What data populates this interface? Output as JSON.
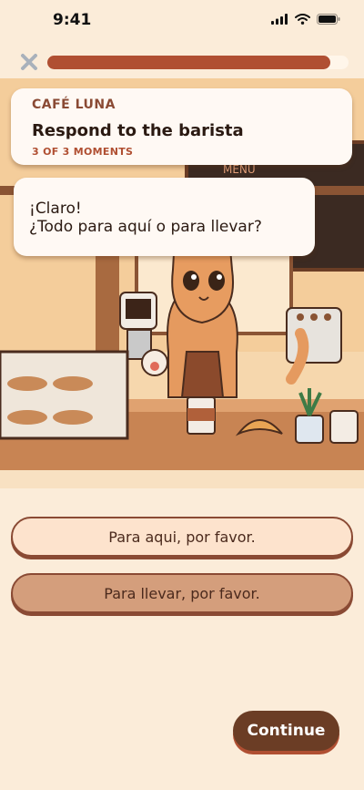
{
  "status_bar": {
    "time": "9:41"
  },
  "progress": {
    "value": 0.94
  },
  "scene": {
    "sign_text": "MENU"
  },
  "card": {
    "kicker": "CAFÉ LUNA",
    "title": "Respond to the barista",
    "meta": "3 OF 3 MOMENTS"
  },
  "bubble": {
    "line1": "¡Claro!",
    "line2": "¿Todo para aquí o para llevar?"
  },
  "options": [
    {
      "label": "Para aqui, por favor."
    },
    {
      "label": "Para llevar, por favor."
    }
  ],
  "continue_label": "Continue",
  "colors": {
    "accent": "#b04f32",
    "button": "#6b3d25",
    "background": "#fbecd9"
  }
}
